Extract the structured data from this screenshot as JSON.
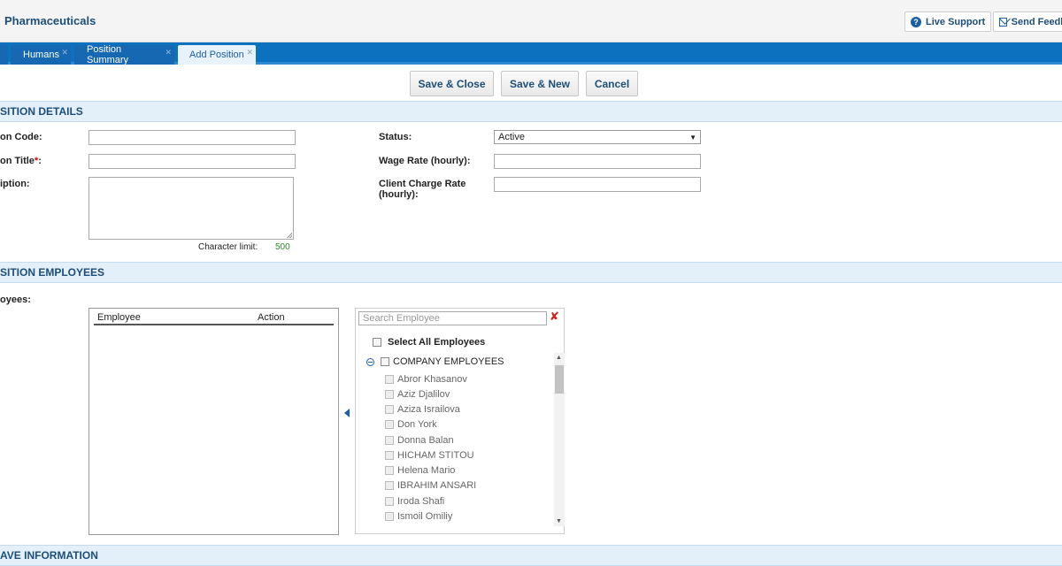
{
  "app": {
    "title": "Pharmaceuticals"
  },
  "top_actions": {
    "live_support": "Live Support",
    "send_feedback": "Send Feedb"
  },
  "tabs": [
    {
      "label": "Humans",
      "active": false
    },
    {
      "label": "Position Summary",
      "active": false
    },
    {
      "label": "Add Position",
      "active": true
    }
  ],
  "toolbar": {
    "save_close": "Save & Close",
    "save_new": "Save & New",
    "cancel": "Cancel"
  },
  "sections": {
    "details": "SITION DETAILS",
    "employees": "SITION EMPLOYEES",
    "leave": "AVE INFORMATION"
  },
  "details": {
    "code_label": "on Code:",
    "title_label": "on Title",
    "title_required": "*",
    "title_colon": ":",
    "description_label": "iption:",
    "char_limit_label": "Character limit:",
    "char_limit_value": "500",
    "status_label": "Status:",
    "status_value": "Active",
    "wage_label": "Wage Rate (hourly):",
    "charge_label": "Client Charge Rate",
    "charge_label_2": "(hourly):"
  },
  "employees": {
    "label": "oyees:",
    "col_employee": "Employee",
    "col_action": "Action",
    "search_placeholder": "Search Employee",
    "select_all": "Select All Employees",
    "group": "COMPANY EMPLOYEES",
    "list": [
      "Abror Khasanov",
      "Aziz Djalilov",
      "Aziza Israilova",
      "Don York",
      "Donna Balan",
      "HICHAM STITOU",
      "Helena Mario",
      "IBRAHIM ANSARI",
      "Iroda Shafi",
      "Ismoil Omiliy"
    ]
  },
  "colors": {
    "accent": "#0c72c0",
    "section_bg": "#e3f0fa",
    "title": "#1d4e78",
    "char_limit": "#2a8a2a"
  },
  "icons": [
    "help-icon",
    "mail-icon",
    "tab-close-icon",
    "dropdown-arrow-icon",
    "clear-search-icon",
    "collapse-icon",
    "move-left-icon",
    "resize-grip-icon"
  ]
}
